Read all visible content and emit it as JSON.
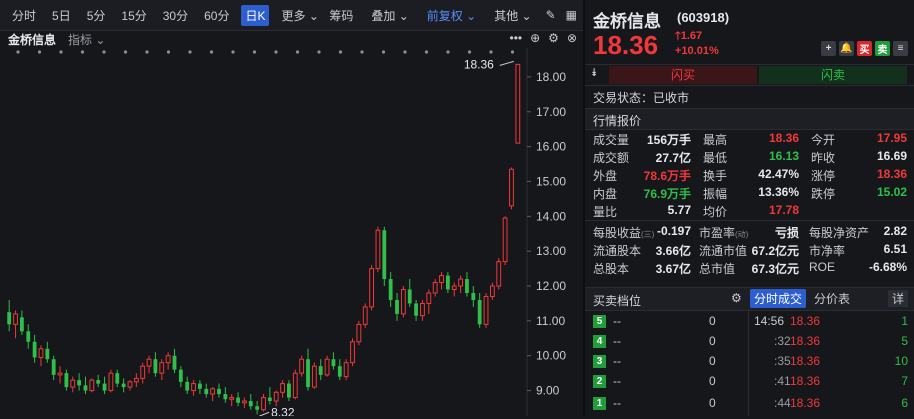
{
  "toolbar": {
    "periods": [
      "分时",
      "5日",
      "5分",
      "15分",
      "30分",
      "60分",
      "日K",
      "更多"
    ],
    "active_period": "日K",
    "right": [
      "筹码",
      "叠加",
      "前复权",
      "其他"
    ]
  },
  "subbar": {
    "stock": "金桥信息",
    "indicator": "指标"
  },
  "chart_data": {
    "type": "candlestick",
    "ylim": [
      8.5,
      18.6
    ],
    "y_ticks": [
      "18.00",
      "17.00",
      "16.00",
      "15.00",
      "14.00",
      "13.00",
      "12.00",
      "11.00",
      "10.00",
      "9.00"
    ],
    "max_label": "18.36",
    "min_label": "8.32",
    "candles": [
      {
        "o": 11.25,
        "h": 11.6,
        "l": 10.7,
        "c": 10.9
      },
      {
        "o": 10.9,
        "h": 11.3,
        "l": 10.5,
        "c": 11.2
      },
      {
        "o": 11.1,
        "h": 11.3,
        "l": 10.6,
        "c": 10.7
      },
      {
        "o": 10.7,
        "h": 10.9,
        "l": 10.2,
        "c": 10.4
      },
      {
        "o": 10.4,
        "h": 10.6,
        "l": 9.8,
        "c": 9.95
      },
      {
        "o": 9.95,
        "h": 10.3,
        "l": 9.7,
        "c": 10.2
      },
      {
        "o": 10.2,
        "h": 10.4,
        "l": 9.8,
        "c": 9.9
      },
      {
        "o": 9.9,
        "h": 10.0,
        "l": 9.3,
        "c": 9.45
      },
      {
        "o": 9.45,
        "h": 9.7,
        "l": 9.2,
        "c": 9.5
      },
      {
        "o": 9.5,
        "h": 9.6,
        "l": 9.0,
        "c": 9.1
      },
      {
        "o": 9.1,
        "h": 9.4,
        "l": 8.95,
        "c": 9.3
      },
      {
        "o": 9.3,
        "h": 9.5,
        "l": 9.0,
        "c": 9.15
      },
      {
        "o": 9.15,
        "h": 9.4,
        "l": 8.9,
        "c": 9.0
      },
      {
        "o": 9.0,
        "h": 9.35,
        "l": 8.95,
        "c": 9.3
      },
      {
        "o": 9.3,
        "h": 9.45,
        "l": 9.1,
        "c": 9.2
      },
      {
        "o": 9.2,
        "h": 9.4,
        "l": 8.9,
        "c": 9.0
      },
      {
        "o": 9.0,
        "h": 9.6,
        "l": 8.95,
        "c": 9.5
      },
      {
        "o": 9.5,
        "h": 9.6,
        "l": 9.1,
        "c": 9.2
      },
      {
        "o": 9.2,
        "h": 9.35,
        "l": 8.95,
        "c": 9.1
      },
      {
        "o": 9.1,
        "h": 9.3,
        "l": 9.0,
        "c": 9.25
      },
      {
        "o": 9.25,
        "h": 9.5,
        "l": 9.1,
        "c": 9.35
      },
      {
        "o": 9.35,
        "h": 9.8,
        "l": 9.2,
        "c": 9.7
      },
      {
        "o": 9.7,
        "h": 10.0,
        "l": 9.5,
        "c": 9.9
      },
      {
        "o": 9.9,
        "h": 10.1,
        "l": 9.4,
        "c": 9.5
      },
      {
        "o": 9.5,
        "h": 9.9,
        "l": 9.3,
        "c": 9.8
      },
      {
        "o": 9.8,
        "h": 10.1,
        "l": 9.6,
        "c": 10.0
      },
      {
        "o": 10.0,
        "h": 10.2,
        "l": 9.5,
        "c": 9.6
      },
      {
        "o": 9.6,
        "h": 9.7,
        "l": 9.1,
        "c": 9.25
      },
      {
        "o": 9.25,
        "h": 9.4,
        "l": 8.9,
        "c": 9.0
      },
      {
        "o": 9.0,
        "h": 9.3,
        "l": 8.85,
        "c": 9.2
      },
      {
        "o": 9.2,
        "h": 9.3,
        "l": 8.9,
        "c": 9.05
      },
      {
        "o": 9.05,
        "h": 9.2,
        "l": 8.8,
        "c": 8.9
      },
      {
        "o": 8.9,
        "h": 9.1,
        "l": 8.7,
        "c": 9.05
      },
      {
        "o": 9.05,
        "h": 9.2,
        "l": 8.8,
        "c": 8.9
      },
      {
        "o": 8.9,
        "h": 9.1,
        "l": 8.65,
        "c": 8.75
      },
      {
        "o": 8.75,
        "h": 8.9,
        "l": 8.55,
        "c": 8.8
      },
      {
        "o": 8.8,
        "h": 8.95,
        "l": 8.55,
        "c": 8.65
      },
      {
        "o": 8.65,
        "h": 8.8,
        "l": 8.5,
        "c": 8.7
      },
      {
        "o": 8.7,
        "h": 8.9,
        "l": 8.45,
        "c": 8.55
      },
      {
        "o": 8.55,
        "h": 8.7,
        "l": 8.32,
        "c": 8.45
      },
      {
        "o": 8.45,
        "h": 8.9,
        "l": 8.4,
        "c": 8.8
      },
      {
        "o": 8.8,
        "h": 9.1,
        "l": 8.6,
        "c": 8.7
      },
      {
        "o": 8.7,
        "h": 9.0,
        "l": 8.55,
        "c": 8.95
      },
      {
        "o": 8.95,
        "h": 9.3,
        "l": 8.8,
        "c": 9.2
      },
      {
        "o": 9.2,
        "h": 9.3,
        "l": 8.7,
        "c": 8.8
      },
      {
        "o": 8.8,
        "h": 9.6,
        "l": 8.75,
        "c": 9.5
      },
      {
        "o": 9.5,
        "h": 10.0,
        "l": 9.4,
        "c": 9.9
      },
      {
        "o": 9.9,
        "h": 10.2,
        "l": 9.0,
        "c": 9.1
      },
      {
        "o": 9.1,
        "h": 9.8,
        "l": 9.05,
        "c": 9.7
      },
      {
        "o": 9.7,
        "h": 9.9,
        "l": 9.3,
        "c": 9.45
      },
      {
        "o": 9.45,
        "h": 10.0,
        "l": 9.4,
        "c": 9.9
      },
      {
        "o": 9.9,
        "h": 10.1,
        "l": 9.6,
        "c": 9.7
      },
      {
        "o": 9.7,
        "h": 9.9,
        "l": 9.3,
        "c": 9.4
      },
      {
        "o": 9.4,
        "h": 9.9,
        "l": 9.3,
        "c": 9.8
      },
      {
        "o": 9.8,
        "h": 10.5,
        "l": 9.7,
        "c": 10.4
      },
      {
        "o": 10.4,
        "h": 11.0,
        "l": 10.3,
        "c": 10.9
      },
      {
        "o": 10.9,
        "h": 11.5,
        "l": 10.8,
        "c": 11.4
      },
      {
        "o": 11.4,
        "h": 12.6,
        "l": 11.3,
        "c": 12.5
      },
      {
        "o": 12.5,
        "h": 13.7,
        "l": 12.4,
        "c": 13.6
      },
      {
        "o": 13.6,
        "h": 13.7,
        "l": 12.0,
        "c": 12.2
      },
      {
        "o": 12.2,
        "h": 12.4,
        "l": 11.4,
        "c": 11.6
      },
      {
        "o": 11.6,
        "h": 11.8,
        "l": 11.0,
        "c": 11.2
      },
      {
        "o": 11.2,
        "h": 12.0,
        "l": 11.1,
        "c": 11.9
      },
      {
        "o": 11.9,
        "h": 12.2,
        "l": 11.4,
        "c": 11.5
      },
      {
        "o": 11.5,
        "h": 11.6,
        "l": 11.0,
        "c": 11.15
      },
      {
        "o": 11.15,
        "h": 11.6,
        "l": 11.0,
        "c": 11.5
      },
      {
        "o": 11.5,
        "h": 11.9,
        "l": 11.2,
        "c": 11.8
      },
      {
        "o": 11.8,
        "h": 12.2,
        "l": 11.7,
        "c": 12.1
      },
      {
        "o": 12.1,
        "h": 12.4,
        "l": 11.9,
        "c": 12.3
      },
      {
        "o": 12.3,
        "h": 12.4,
        "l": 11.8,
        "c": 11.9
      },
      {
        "o": 11.9,
        "h": 12.1,
        "l": 11.7,
        "c": 12.0
      },
      {
        "o": 12.0,
        "h": 12.3,
        "l": 11.8,
        "c": 12.2
      },
      {
        "o": 12.2,
        "h": 12.4,
        "l": 11.7,
        "c": 11.8
      },
      {
        "o": 11.8,
        "h": 12.0,
        "l": 11.4,
        "c": 11.6
      },
      {
        "o": 11.6,
        "h": 11.8,
        "l": 10.8,
        "c": 10.9
      },
      {
        "o": 10.9,
        "h": 11.8,
        "l": 10.8,
        "c": 11.7
      },
      {
        "o": 11.7,
        "h": 12.1,
        "l": 11.6,
        "c": 12.0
      },
      {
        "o": 12.0,
        "h": 12.8,
        "l": 11.9,
        "c": 12.7
      },
      {
        "o": 12.7,
        "h": 14.0,
        "l": 12.6,
        "c": 13.95
      },
      {
        "o": 14.3,
        "h": 15.4,
        "l": 14.2,
        "c": 15.35
      },
      {
        "o": 16.1,
        "h": 18.36,
        "l": 16.1,
        "c": 18.36
      }
    ]
  },
  "quote": {
    "name": "金桥信息",
    "code": "(603918)",
    "price": "18.36",
    "change": "1.67",
    "pct": "+10.01%",
    "buttons": [
      "+",
      "🔔",
      "买",
      "卖"
    ]
  },
  "trade": {
    "buy": "闪买",
    "sell": "闪卖"
  },
  "status": "交易状态：已收市",
  "section_quote": "行情报价",
  "stats": {
    "vol_l": "成交量",
    "vol_v": "156万手",
    "high_l": "最高",
    "high_v": "18.36",
    "open_l": "今开",
    "open_v": "17.95",
    "amt_l": "成交额",
    "amt_v": "27.7亿",
    "low_l": "最低",
    "low_v": "16.13",
    "prev_l": "昨收",
    "prev_v": "16.69",
    "out_l": "外盘",
    "out_v": "78.6万手",
    "turn_l": "换手",
    "turn_v": "42.47%",
    "up_l": "涨停",
    "up_v": "18.36",
    "in_l": "内盘",
    "in_v": "76.9万手",
    "amp_l": "振幅",
    "amp_v": "13.36%",
    "down_l": "跌停",
    "down_v": "15.02",
    "ratio_l": "量比",
    "ratio_v": "5.77",
    "avg_l": "均价",
    "avg_v": "17.78",
    "eps_l": "每股收益",
    "eps_sup": "(三)",
    "eps_v": "-0.197",
    "pe_l": "市盈率",
    "pe_sup": "(动)",
    "pe_v": "亏损",
    "bps_l": "每股净资产",
    "bps_v": "2.82",
    "fshare_l": "流通股本",
    "fshare_v": "3.66亿",
    "fcap_l": "流通市值",
    "fcap_v": "67.2亿元",
    "pb_l": "市净率",
    "pb_v": "6.51",
    "tshare_l": "总股本",
    "tshare_v": "3.67亿",
    "tcap_l": "总市值",
    "tcap_v": "67.3亿元",
    "roe_l": "ROE",
    "roe_v": "-6.68%"
  },
  "orderbook": {
    "title": "买卖档位",
    "rows": [
      {
        "n": "5",
        "price": "--",
        "qty": "0"
      },
      {
        "n": "4",
        "price": "--",
        "qty": "0"
      },
      {
        "n": "3",
        "price": "--",
        "qty": "0"
      },
      {
        "n": "2",
        "price": "--",
        "qty": "0"
      },
      {
        "n": "1",
        "price": "--",
        "qty": "0"
      }
    ]
  },
  "ticks": {
    "tab_active": "分时成交",
    "tab2": "分价表",
    "detail": "详",
    "rows": [
      {
        "t": "14:56",
        "p": "18.36",
        "v": "1"
      },
      {
        "t": ":32",
        "p": "18.36",
        "v": "5"
      },
      {
        "t": ":35",
        "p": "18.36",
        "v": "10"
      },
      {
        "t": ":41",
        "p": "18.36",
        "v": "7"
      },
      {
        "t": ":44",
        "p": "18.36",
        "v": "6"
      }
    ]
  },
  "colors": {
    "up": "#f0383a",
    "down": "#2fbf4a",
    "accent": "#2d5ecf"
  }
}
